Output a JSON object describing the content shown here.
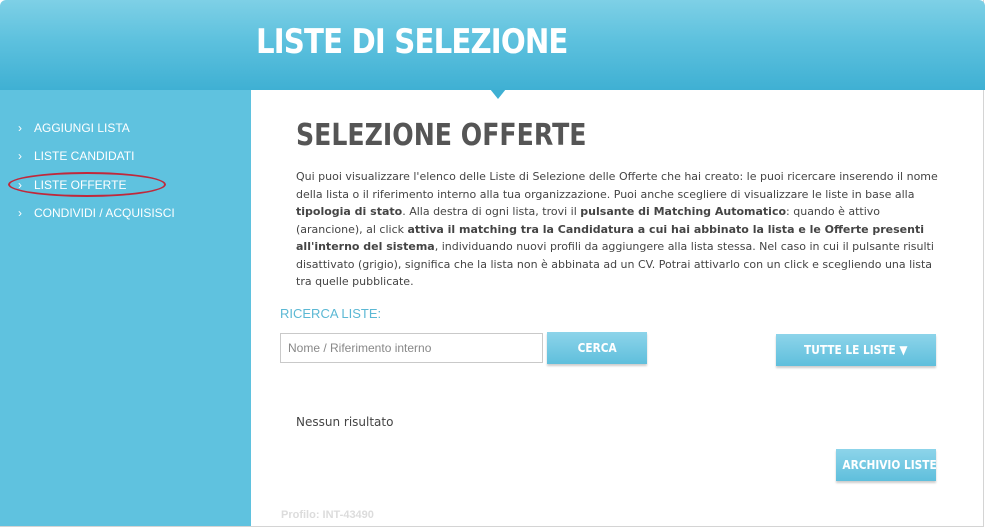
{
  "header": {
    "title": "LISTE DI SELEZIONE"
  },
  "sidebar": {
    "items": [
      {
        "label": "AGGIUNGI LISTA",
        "icon": "chevron-right-icon"
      },
      {
        "label": "LISTE CANDIDATI",
        "icon": "chevron-right-icon"
      },
      {
        "label": "LISTE OFFERTE",
        "icon": "chevron-right-icon",
        "highlighted": true
      },
      {
        "label": "CONDIVIDI / ACQUISISCI",
        "icon": "chevron-right-icon"
      }
    ]
  },
  "main": {
    "title": "SELEZIONE OFFERTE",
    "description": {
      "p1": "Qui puoi visualizzare l'elenco delle Liste di Selezione delle Offerte che hai creato: le puoi ricercare inserendo il nome della lista o il riferimento interno alla tua organizzazione. Puoi anche scegliere di visualizzare le liste in base alla ",
      "b1": "tipologia di stato",
      "p2": ". Alla destra di ogni lista, trovi il ",
      "b2": "pulsante di Matching Automatico",
      "p3": ": quando è attivo (arancione), al click ",
      "b3": "attiva il matching tra la Candidatura a cui hai abbinato la lista e le Offerte presenti all'interno del sistema",
      "p4": ", individuando nuovi profili da aggiungere alla lista stessa. Nel caso in cui il pulsante risulti disattivato (grigio), significa che la lista non è abbinata ad un CV. Potrai attivarlo con un click e scegliendo una lista tra quelle pubblicate."
    },
    "search": {
      "label": "RICERCA LISTE:",
      "placeholder": "Nome / Riferimento interno",
      "value": "",
      "button_label": "CERCA"
    },
    "filter": {
      "label": "TUTTE LE LISTE ▼"
    },
    "no_results": "Nessun risultato",
    "archive_button": "ARCHIVIO LISTE"
  },
  "footer": {
    "profile": "Profilo: INT-43490"
  },
  "colors": {
    "accent": "#5fc2df",
    "header": "#3fb0d3",
    "annotation": "#c0283b",
    "title": "#555555"
  }
}
